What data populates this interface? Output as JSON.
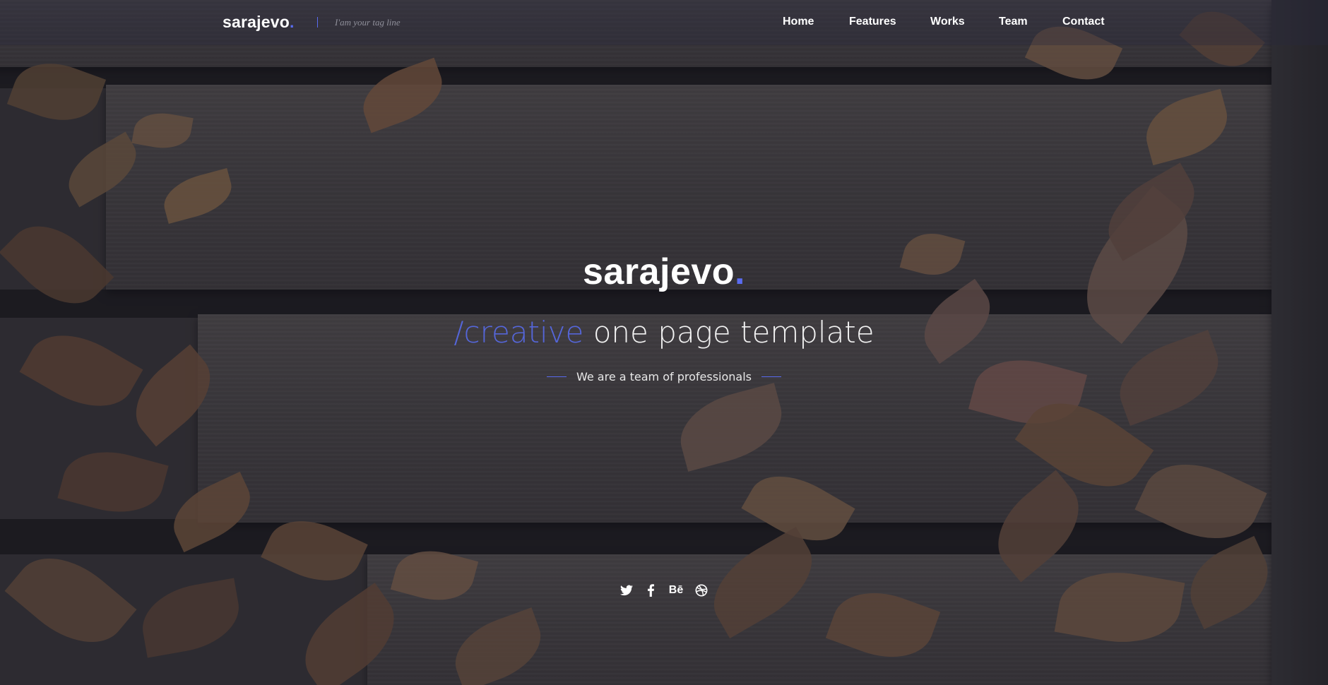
{
  "header": {
    "brand_name": "sarajevo",
    "brand_dot": ".",
    "tagline": "I'am your tag line"
  },
  "nav": {
    "items": [
      {
        "label": "Home"
      },
      {
        "label": "Features"
      },
      {
        "label": "Works"
      },
      {
        "label": "Team"
      },
      {
        "label": "Contact"
      }
    ]
  },
  "hero": {
    "title": "sarajevo",
    "title_dot": ".",
    "subtitle_accent": "/creative",
    "subtitle_rest": " one page template",
    "tagline": "We are a team of professionals"
  },
  "social": {
    "icons": [
      {
        "name": "twitter-icon"
      },
      {
        "name": "facebook-icon"
      },
      {
        "name": "behance-icon",
        "text": "Bē"
      },
      {
        "name": "dribbble-icon"
      }
    ]
  },
  "colors": {
    "accent": "#5a6cf0",
    "text": "#ffffff",
    "overlay": "#1e1e2d"
  }
}
